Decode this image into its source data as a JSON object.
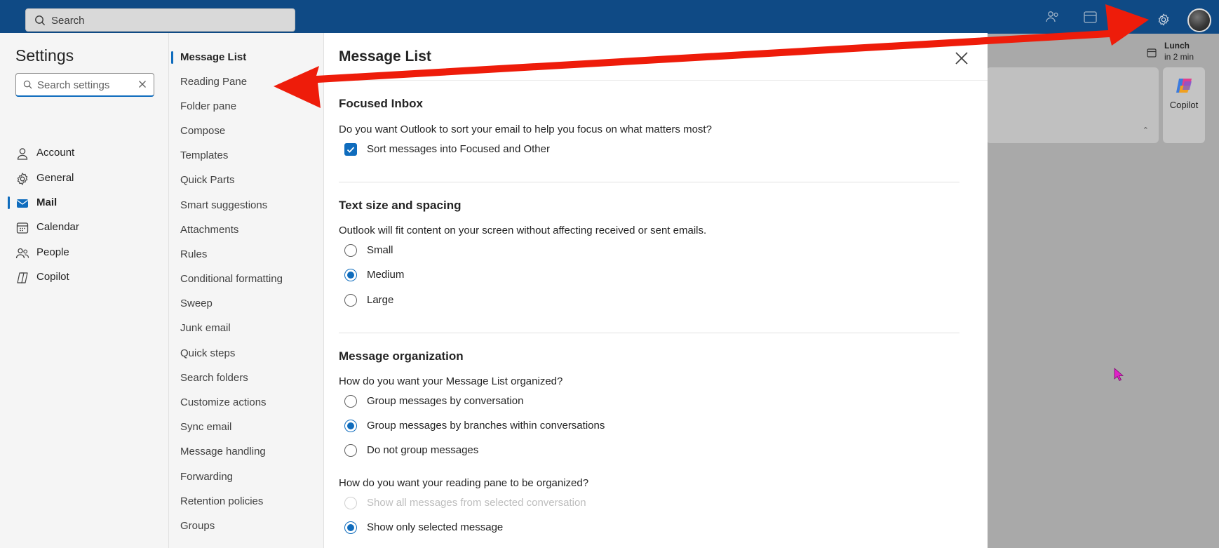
{
  "topbar": {
    "search_placeholder": "Search",
    "icons": [
      "people-icon",
      "calendar-icon",
      "settings-gear-icon",
      "avatar"
    ]
  },
  "background": {
    "lunch_title": "Lunch",
    "lunch_time": "in 2 min",
    "copilot_label": "Copilot"
  },
  "settings": {
    "title": "Settings",
    "search_placeholder": "Search settings",
    "categories": [
      {
        "label": "Account",
        "icon": "person-icon",
        "active": false
      },
      {
        "label": "General",
        "icon": "gear-icon",
        "active": false
      },
      {
        "label": "Mail",
        "icon": "mail-icon",
        "active": true
      },
      {
        "label": "Calendar",
        "icon": "calendar-icon",
        "active": false
      },
      {
        "label": "People",
        "icon": "people-icon",
        "active": false
      },
      {
        "label": "Copilot",
        "icon": "copilot-icon",
        "active": false
      }
    ],
    "subcategories": [
      "Message List",
      "Reading Pane",
      "Folder pane",
      "Compose",
      "Templates",
      "Quick Parts",
      "Smart suggestions",
      "Attachments",
      "Rules",
      "Conditional formatting",
      "Sweep",
      "Junk email",
      "Quick steps",
      "Search folders",
      "Customize actions",
      "Sync email",
      "Message handling",
      "Forwarding",
      "Retention policies",
      "Groups"
    ],
    "active_subcategory": "Message List"
  },
  "content": {
    "title": "Message List",
    "focused": {
      "heading": "Focused Inbox",
      "question": "Do you want Outlook to sort your email to help you focus on what matters most?",
      "checkbox_label": "Sort messages into Focused and Other",
      "checked": true
    },
    "text_size": {
      "heading": "Text size and spacing",
      "question": "Outlook will fit content on your screen without affecting received or sent emails.",
      "options": [
        "Small",
        "Medium",
        "Large"
      ],
      "selected": "Medium"
    },
    "organization": {
      "heading": "Message organization",
      "question1": "How do you want your Message List organized?",
      "options1": [
        "Group messages by conversation",
        "Group messages by branches within conversations",
        "Do not group messages"
      ],
      "selected1": "Group messages by branches within conversations",
      "question2": "How do you want your reading pane to be organized?",
      "options2": [
        "Show all messages from selected conversation",
        "Show only selected message"
      ],
      "selected2": "Show only selected message",
      "disabled2": "Show all messages from selected conversation"
    }
  },
  "colors": {
    "topbar": "#0f4a85",
    "accent": "#0f6cbd",
    "annotation_arrow": "#ee1c0a"
  }
}
